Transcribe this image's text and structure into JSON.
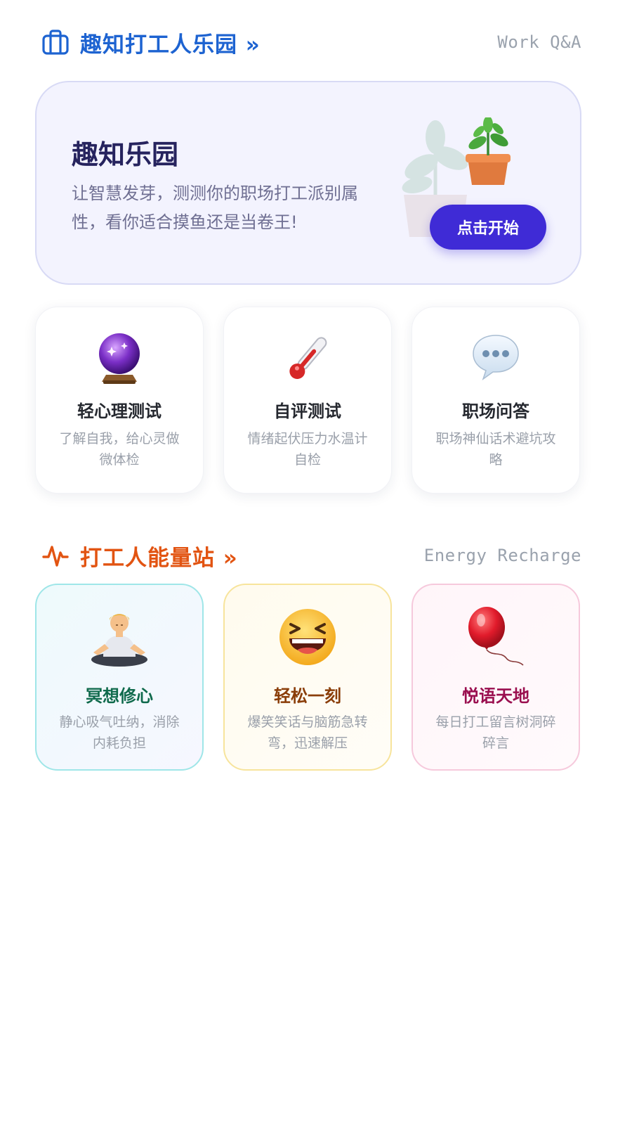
{
  "section_work": {
    "title": "趣知打工人乐园 »",
    "subtitle": "Work Q&A",
    "icon": "briefcase-icon",
    "accent": "#1d63d1"
  },
  "banner": {
    "title": "趣知乐园",
    "description": "让智慧发芽，测测你的职场打工派别属性，看你适合摸鱼还是当卷王!",
    "button_label": "点击开始",
    "icon": "potted-plant-icon",
    "button_color": "#3f2bd6"
  },
  "work_cards": [
    {
      "title": "轻心理测试",
      "description": "了解自我，给心灵做微体检",
      "icon": "crystal-ball-icon"
    },
    {
      "title": "自评测试",
      "description": "情绪起伏压力水温计自检",
      "icon": "thermometer-icon"
    },
    {
      "title": "职场问答",
      "description": "职场神仙话术避坑攻略",
      "icon": "speech-bubble-icon"
    }
  ],
  "section_energy": {
    "title": "打工人能量站 »",
    "subtitle": "Energy Recharge",
    "icon": "pulse-icon",
    "accent": "#e25412"
  },
  "energy_cards": [
    {
      "title": "冥想修心",
      "description": "静心吸气吐纳，消除内耗负担",
      "icon": "meditation-person-icon",
      "title_color": "#0f6a4c",
      "border_color": "#9fe6e8"
    },
    {
      "title": "轻松一刻",
      "description": "爆笑笑话与脑筋急转弯，迅速解压",
      "icon": "laughing-face-icon",
      "title_color": "#8a3d08",
      "border_color": "#f7e49c"
    },
    {
      "title": "悦语天地",
      "description": "每日打工留言树洞碎碎言",
      "icon": "red-balloon-icon",
      "title_color": "#9a0f4f",
      "border_color": "#f6c9dc"
    }
  ]
}
